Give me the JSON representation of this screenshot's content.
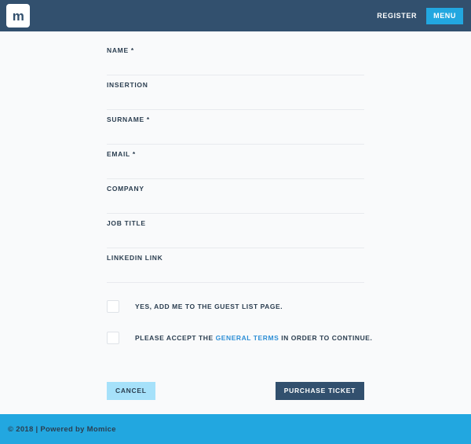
{
  "header": {
    "logo_letter": "m",
    "register_label": "REGISTER",
    "menu_label": "MENU",
    "background_color": "#32506e",
    "menu_color": "#22a7e0"
  },
  "form": {
    "fields": [
      {
        "label": "NAME *",
        "value": "",
        "placeholder": ""
      },
      {
        "label": "INSERTION",
        "value": "",
        "placeholder": ""
      },
      {
        "label": "SURNAME *",
        "value": "",
        "placeholder": ""
      },
      {
        "label": "EMAIL *",
        "value": "",
        "placeholder": ""
      },
      {
        "label": "COMPANY",
        "value": "",
        "placeholder": ""
      },
      {
        "label": "JOB TITLE",
        "value": "",
        "placeholder": ""
      },
      {
        "label": "LINKEDIN LINK",
        "value": "",
        "placeholder": ""
      }
    ],
    "checkboxes": [
      {
        "label_full": "YES, ADD ME TO THE GUEST LIST PAGE.",
        "label_before": "YES, ADD ME TO THE GUEST LIST PAGE.",
        "link_text": "",
        "label_after": "",
        "checked": false
      },
      {
        "label_full": "PLEASE ACCEPT THE GENERAL TERMS IN ORDER TO CONTINUE.",
        "label_before": "PLEASE ACCEPT THE ",
        "link_text": "GENERAL TERMS",
        "label_after": " IN ORDER TO CONTINUE.",
        "checked": false
      }
    ],
    "cancel_label": "CANCEL",
    "purchase_label": "PURCHASE TICKET",
    "link_color": "#2e8fd6"
  },
  "footer": {
    "text": "© 2018 | Powered by Momice",
    "background_color": "#22a7e0"
  }
}
